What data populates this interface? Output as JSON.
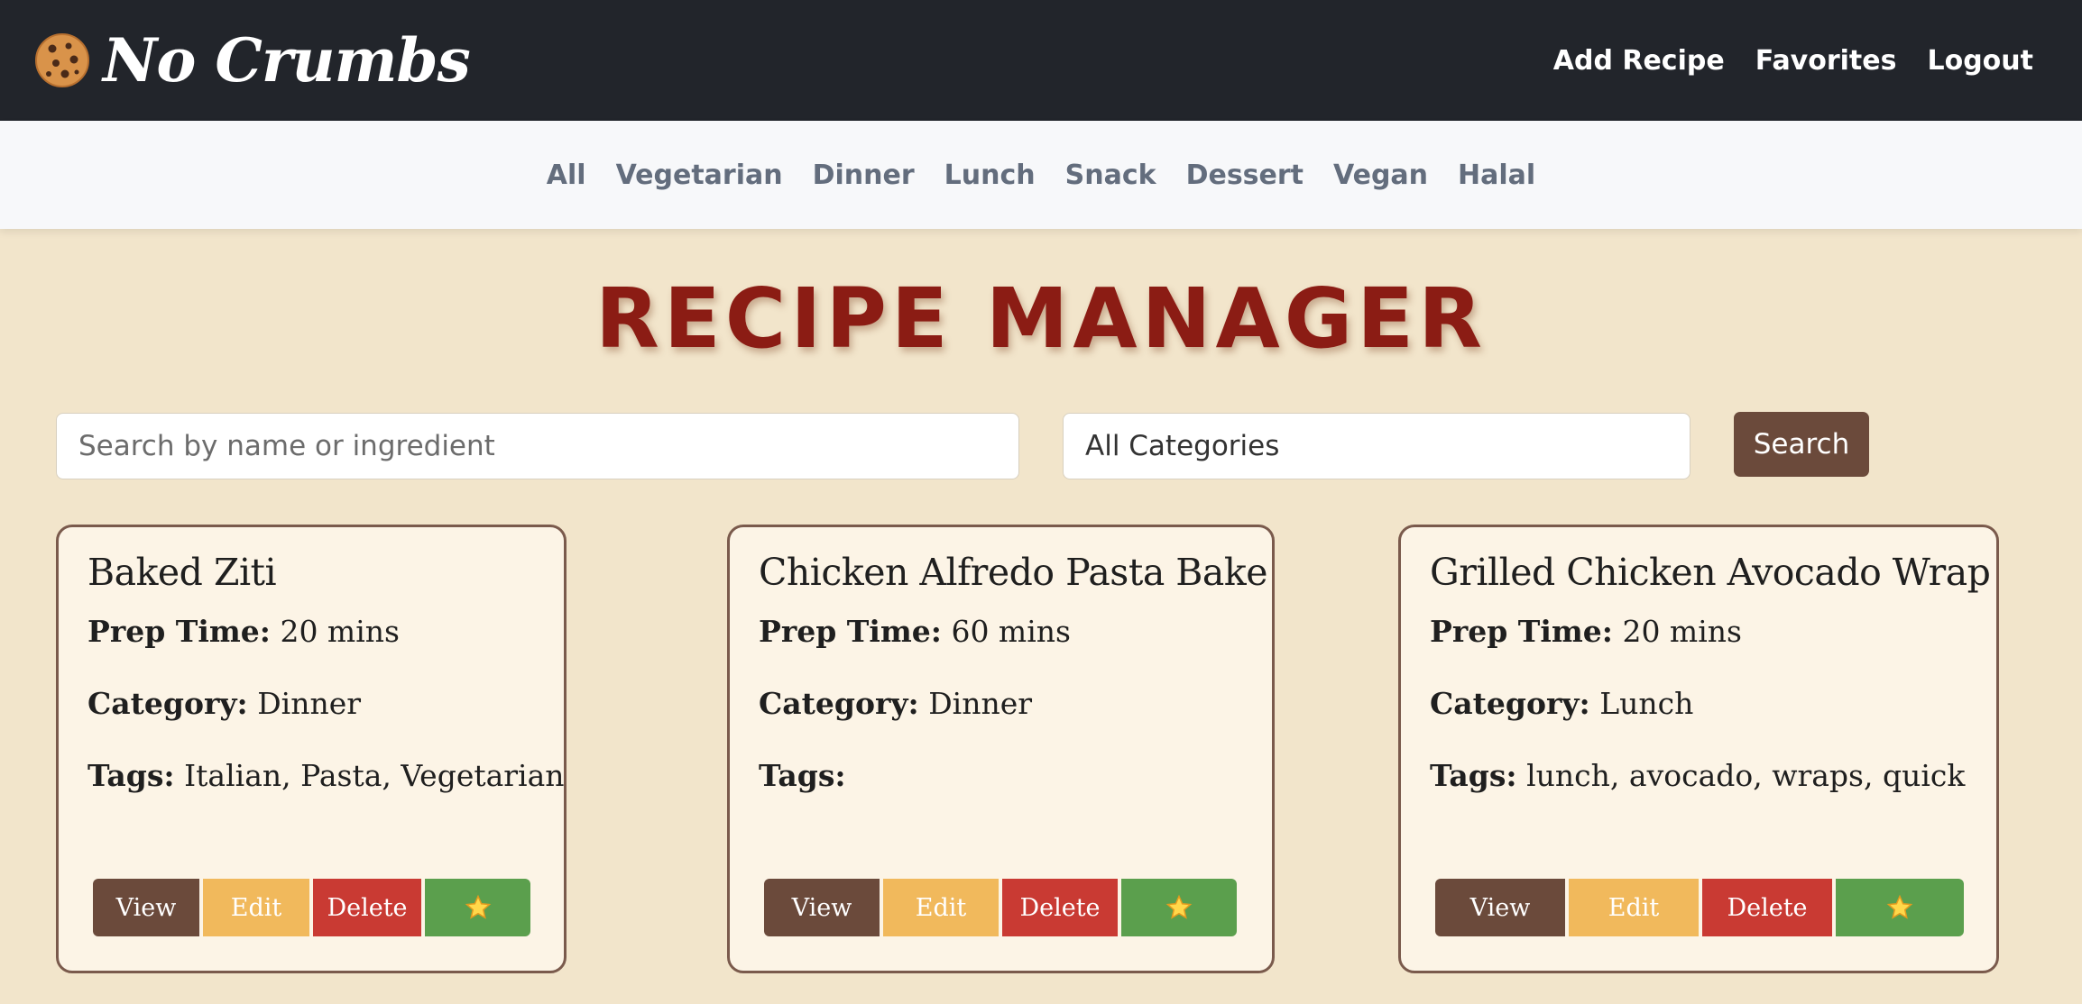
{
  "navbar": {
    "brand": "No Crumbs",
    "links": [
      "Add Recipe",
      "Favorites",
      "Logout"
    ]
  },
  "categories": [
    "All",
    "Vegetarian",
    "Dinner",
    "Lunch",
    "Snack",
    "Dessert",
    "Vegan",
    "Halal"
  ],
  "page_title": "RECIPE MANAGER",
  "search": {
    "placeholder": "Search by name or ingredient",
    "value": "",
    "category_selected": "All Categories",
    "button_label": "Search"
  },
  "labels": {
    "prep_time": "Prep Time:",
    "category": "Category:",
    "tags": "Tags:"
  },
  "card_buttons": {
    "view": "View",
    "edit": "Edit",
    "delete": "Delete",
    "favorite_icon": "star-icon"
  },
  "recipes": [
    {
      "name": "Baked Ziti",
      "prep_time": "20 mins",
      "category": "Dinner",
      "tags": "Italian, Pasta, Vegetarian"
    },
    {
      "name": "Chicken Alfredo Pasta Bake",
      "prep_time": "60 mins",
      "category": "Dinner",
      "tags": ""
    },
    {
      "name": "Grilled Chicken Avocado Wrap",
      "prep_time": "20 mins",
      "category": "Lunch",
      "tags": "lunch, avocado, wraps, quick"
    }
  ],
  "colors": {
    "navbar_bg": "#22252b",
    "page_bg": "#f2e5cb",
    "title": "#8b1c14",
    "view_button": "#6b4a3b",
    "edit_button": "#f1b95c",
    "delete_button": "#c93a33",
    "favorite_button": "#5b9f4d"
  }
}
